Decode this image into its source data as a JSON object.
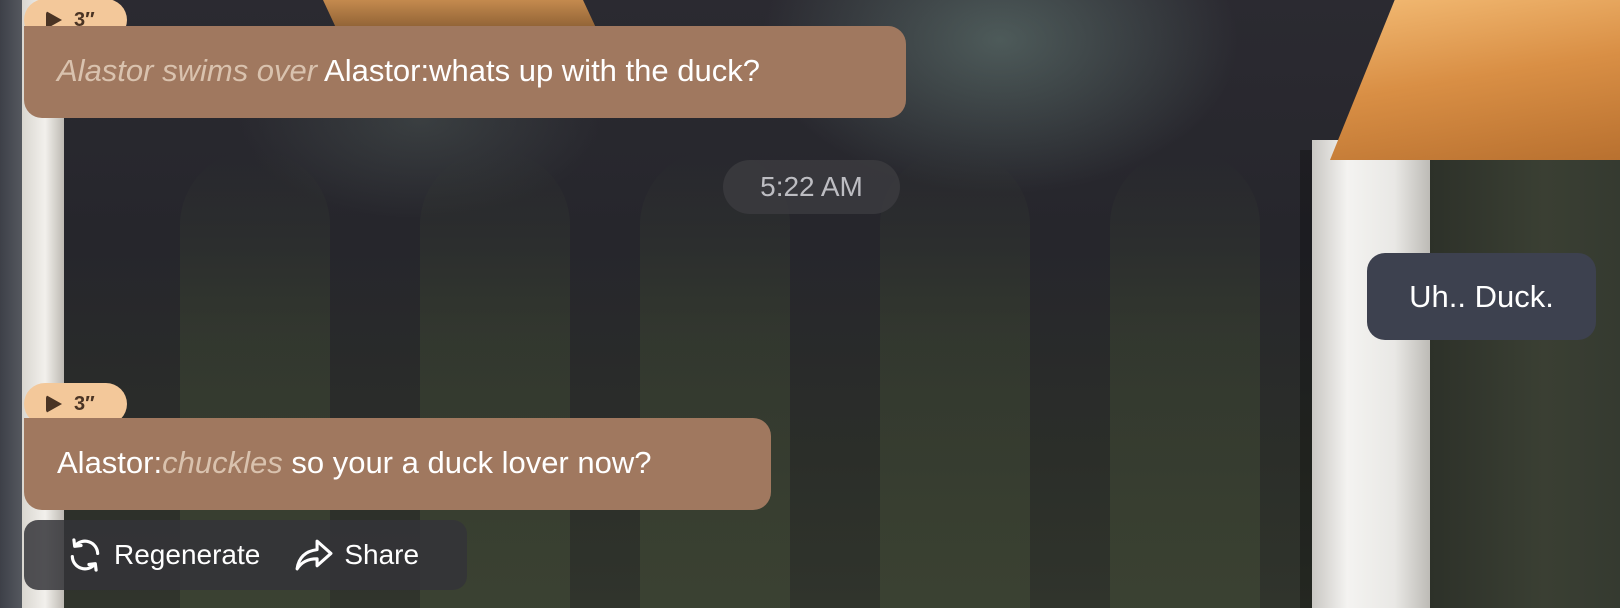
{
  "messages": [
    {
      "role": "bot",
      "audio_duration": "3″",
      "action_text": "Alastor swims over",
      "text": "Alastor:whats up with the duck?"
    },
    {
      "role": "timestamp",
      "text": "5:22 AM"
    },
    {
      "role": "user",
      "text": "Uh.. Duck."
    },
    {
      "role": "bot",
      "audio_duration": "3″",
      "speaker": "Alastor:",
      "action_text": "chuckles",
      "text": "so your a duck lover now?"
    }
  ],
  "actions": {
    "regenerate_label": "Regenerate",
    "share_label": "Share"
  },
  "colors": {
    "bot_bubble": "#a0785f",
    "user_bubble": "#3d414f",
    "audio_pill": "#f3c89a",
    "action_text": "#d9c2ae"
  },
  "icons": {
    "audio": "play-icon",
    "regenerate": "refresh-icon",
    "share": "share-arrow-icon"
  }
}
